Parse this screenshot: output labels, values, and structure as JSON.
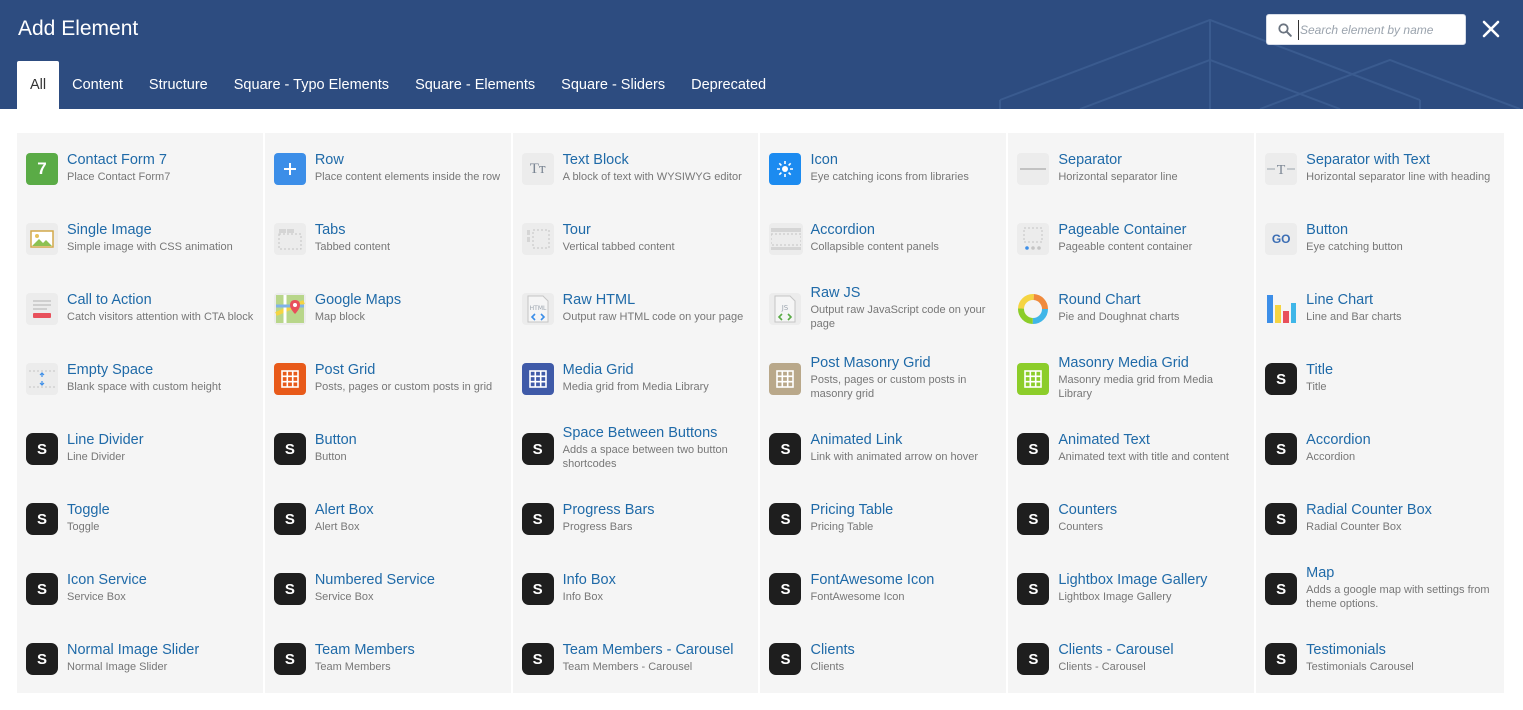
{
  "header": {
    "title": "Add Element",
    "search_placeholder": "Search element by name",
    "search_value": "",
    "close_icon": "close-icon",
    "background": "#2d4c80"
  },
  "tabs": [
    {
      "label": "All",
      "active": true
    },
    {
      "label": "Content",
      "active": false
    },
    {
      "label": "Structure",
      "active": false
    },
    {
      "label": "Square - Typo Elements",
      "active": false
    },
    {
      "label": "Square - Elements",
      "active": false
    },
    {
      "label": "Square - Sliders",
      "active": false
    },
    {
      "label": "Deprecated",
      "active": false
    }
  ],
  "elements": [
    {
      "name": "Contact Form 7",
      "desc": "Place Contact Form7",
      "icon": "cf7"
    },
    {
      "name": "Row",
      "desc": "Place content elements inside the row",
      "icon": "row"
    },
    {
      "name": "Text Block",
      "desc": "A block of text with WYSIWYG editor",
      "icon": "text-block"
    },
    {
      "name": "Icon",
      "desc": "Eye catching icons from libraries",
      "icon": "icon"
    },
    {
      "name": "Separator",
      "desc": "Horizontal separator line",
      "icon": "separator"
    },
    {
      "name": "Separator with Text",
      "desc": "Horizontal separator line with heading",
      "icon": "separator-text"
    },
    {
      "name": "Single Image",
      "desc": "Simple image with CSS animation",
      "icon": "image"
    },
    {
      "name": "Tabs",
      "desc": "Tabbed content",
      "icon": "tabs"
    },
    {
      "name": "Tour",
      "desc": "Vertical tabbed content",
      "icon": "tour"
    },
    {
      "name": "Accordion",
      "desc": "Collapsible content panels",
      "icon": "accordion"
    },
    {
      "name": "Pageable Container",
      "desc": "Pageable content container",
      "icon": "pageable"
    },
    {
      "name": "Button",
      "desc": "Eye catching button",
      "icon": "go"
    },
    {
      "name": "Call to Action",
      "desc": "Catch visitors attention with CTA block",
      "icon": "cta"
    },
    {
      "name": "Google Maps",
      "desc": "Map block",
      "icon": "maps"
    },
    {
      "name": "Raw HTML",
      "desc": "Output raw HTML code on your page",
      "icon": "raw-html"
    },
    {
      "name": "Raw JS",
      "desc": "Output raw JavaScript code on your page",
      "icon": "raw-js"
    },
    {
      "name": "Round Chart",
      "desc": "Pie and Doughnat charts",
      "icon": "round-chart"
    },
    {
      "name": "Line Chart",
      "desc": "Line and Bar charts",
      "icon": "line-chart"
    },
    {
      "name": "Empty Space",
      "desc": "Blank space with custom height",
      "icon": "empty-space"
    },
    {
      "name": "Post Grid",
      "desc": "Posts, pages or custom posts in grid",
      "icon": "grid-orange"
    },
    {
      "name": "Media Grid",
      "desc": "Media grid from Media Library",
      "icon": "grid-blue"
    },
    {
      "name": "Post Masonry Grid",
      "desc": "Posts, pages or custom posts in masonry grid",
      "icon": "grid-tan"
    },
    {
      "name": "Masonry Media Grid",
      "desc": "Masonry media grid from Media Library",
      "icon": "grid-green"
    },
    {
      "name": "Title",
      "desc": "Title",
      "icon": "s"
    },
    {
      "name": "Line Divider",
      "desc": "Line Divider",
      "icon": "s"
    },
    {
      "name": "Button",
      "desc": "Button",
      "icon": "s"
    },
    {
      "name": "Space Between Buttons",
      "desc": "Adds a space between two button shortcodes",
      "icon": "s"
    },
    {
      "name": "Animated Link",
      "desc": "Link with animated arrow on hover",
      "icon": "s"
    },
    {
      "name": "Animated Text",
      "desc": "Animated text with title and content",
      "icon": "s"
    },
    {
      "name": "Accordion",
      "desc": "Accordion",
      "icon": "s"
    },
    {
      "name": "Toggle",
      "desc": "Toggle",
      "icon": "s"
    },
    {
      "name": "Alert Box",
      "desc": "Alert Box",
      "icon": "s"
    },
    {
      "name": "Progress Bars",
      "desc": "Progress Bars",
      "icon": "s"
    },
    {
      "name": "Pricing Table",
      "desc": "Pricing Table",
      "icon": "s"
    },
    {
      "name": "Counters",
      "desc": "Counters",
      "icon": "s"
    },
    {
      "name": "Radial Counter Box",
      "desc": "Radial Counter Box",
      "icon": "s"
    },
    {
      "name": "Icon Service",
      "desc": "Service Box",
      "icon": "s"
    },
    {
      "name": "Numbered Service",
      "desc": "Service Box",
      "icon": "s"
    },
    {
      "name": "Info Box",
      "desc": "Info Box",
      "icon": "s"
    },
    {
      "name": "FontAwesome Icon",
      "desc": "FontAwesome Icon",
      "icon": "s"
    },
    {
      "name": "Lightbox Image Gallery",
      "desc": "Lightbox Image Gallery",
      "icon": "s"
    },
    {
      "name": "Map",
      "desc": "Adds a google map with settings from theme options.",
      "icon": "s"
    },
    {
      "name": "Normal Image Slider",
      "desc": "Normal Image Slider",
      "icon": "s"
    },
    {
      "name": "Team Members",
      "desc": "Team Members",
      "icon": "s"
    },
    {
      "name": "Team Members - Carousel",
      "desc": "Team Members - Carousel",
      "icon": "s"
    },
    {
      "name": "Clients",
      "desc": "Clients",
      "icon": "s"
    },
    {
      "name": "Clients - Carousel",
      "desc": "Clients - Carousel",
      "icon": "s"
    },
    {
      "name": "Testimonials",
      "desc": "Testimonials Carousel",
      "icon": "s"
    }
  ],
  "icon_glyphs": {
    "cf7": "7",
    "s": "S",
    "go": "GO",
    "text-block": "Tт",
    "raw-html": "HTML",
    "raw-js": "JS"
  },
  "colors": {
    "link": "#1f6aa8",
    "card_bg": "#f5f5f5",
    "cf7": "#5aab46",
    "row": "#3c8ee8",
    "icon": "#1c8bf0",
    "grid-orange": "#e85a1a",
    "grid-blue": "#3f5aa8",
    "grid-tan": "#b9a88a",
    "grid-green": "#8ccd2a"
  }
}
